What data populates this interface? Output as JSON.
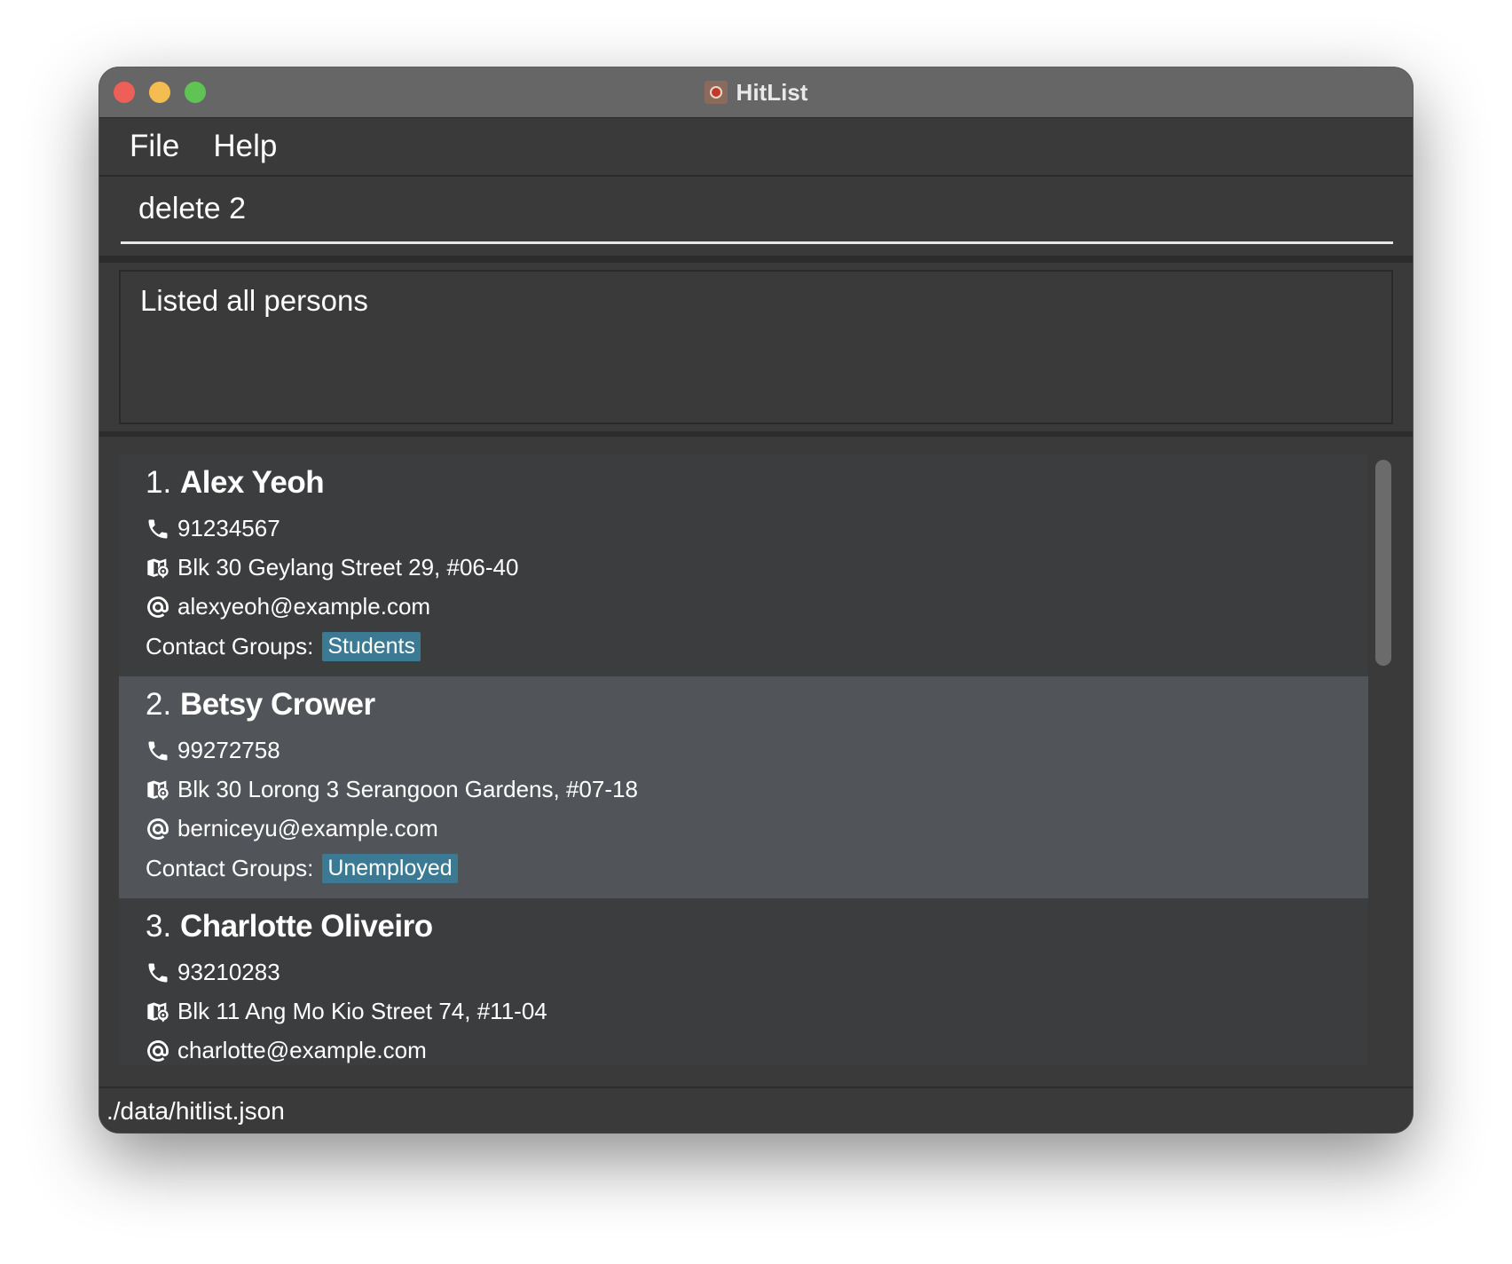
{
  "window": {
    "title": "HitList"
  },
  "menu": {
    "items": [
      "File",
      "Help"
    ]
  },
  "command": {
    "value": "delete 2"
  },
  "result": {
    "message": "Listed all persons"
  },
  "persons": [
    {
      "index": "1.",
      "name": "Alex Yeoh",
      "phone": "91234567",
      "address": "Blk 30 Geylang Street 29, #06-40",
      "email": "alexyeoh@example.com",
      "groups_label": "Contact Groups:",
      "groups": [
        "Students"
      ],
      "selected": false
    },
    {
      "index": "2.",
      "name": "Betsy Crower",
      "phone": "99272758",
      "address": "Blk 30 Lorong 3 Serangoon Gardens, #07-18",
      "email": "berniceyu@example.com",
      "groups_label": "Contact Groups:",
      "groups": [
        "Unemployed"
      ],
      "selected": true
    },
    {
      "index": "3.",
      "name": "Charlotte Oliveiro",
      "phone": "93210283",
      "address": "Blk 11 Ang Mo Kio Street 74, #11-04",
      "email": "charlotte@example.com",
      "groups_label": "Contact Groups:",
      "groups": [],
      "selected": false
    }
  ],
  "status": {
    "path": "./data/hitlist.json"
  },
  "icons": {
    "phone": "phone-icon",
    "address": "map-pin-icon",
    "email": "at-icon",
    "app": "app-icon"
  },
  "colors": {
    "tag": "#3b7a92",
    "selected_row": "#515559",
    "titlebar": "#666666"
  }
}
